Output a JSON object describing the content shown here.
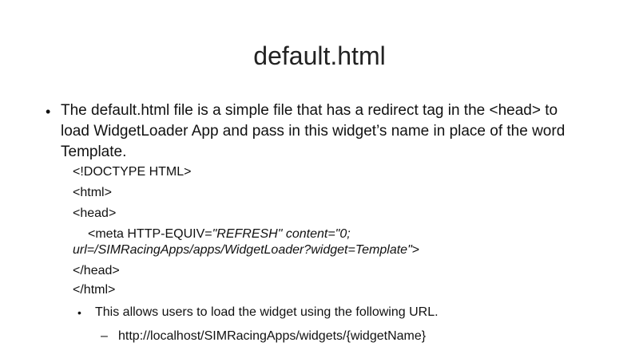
{
  "slide": {
    "title": "default.html",
    "bullet_symbol": "•",
    "sub_bullet_symbol": "•",
    "dash_symbol": "–",
    "main_bullet": "The default.html file is a simple file that has a redirect tag in the <head> to load WidgetLoader App and pass in this widget’s name in place of the word Template.",
    "code": {
      "doctype": "<!DOCTYPE HTML>",
      "html_open": "<html>",
      "head_open": "<head>",
      "meta_prefix": "<meta HTTP-EQUIV=",
      "meta_equiv_value": "\"REFRESH\"",
      "meta_content_attr": " content=\"0;",
      "meta_url_line": "url=/SIMRacingApps/apps/WidgetLoader?widget=Template\"",
      "meta_close": ">",
      "head_close": "</head>",
      "html_close": "</html>"
    },
    "sub_bullet": "This allows users to load the widget using the following URL.",
    "url_item": "http://localhost/SIMRacingApps/widgets/{widgetName}"
  }
}
